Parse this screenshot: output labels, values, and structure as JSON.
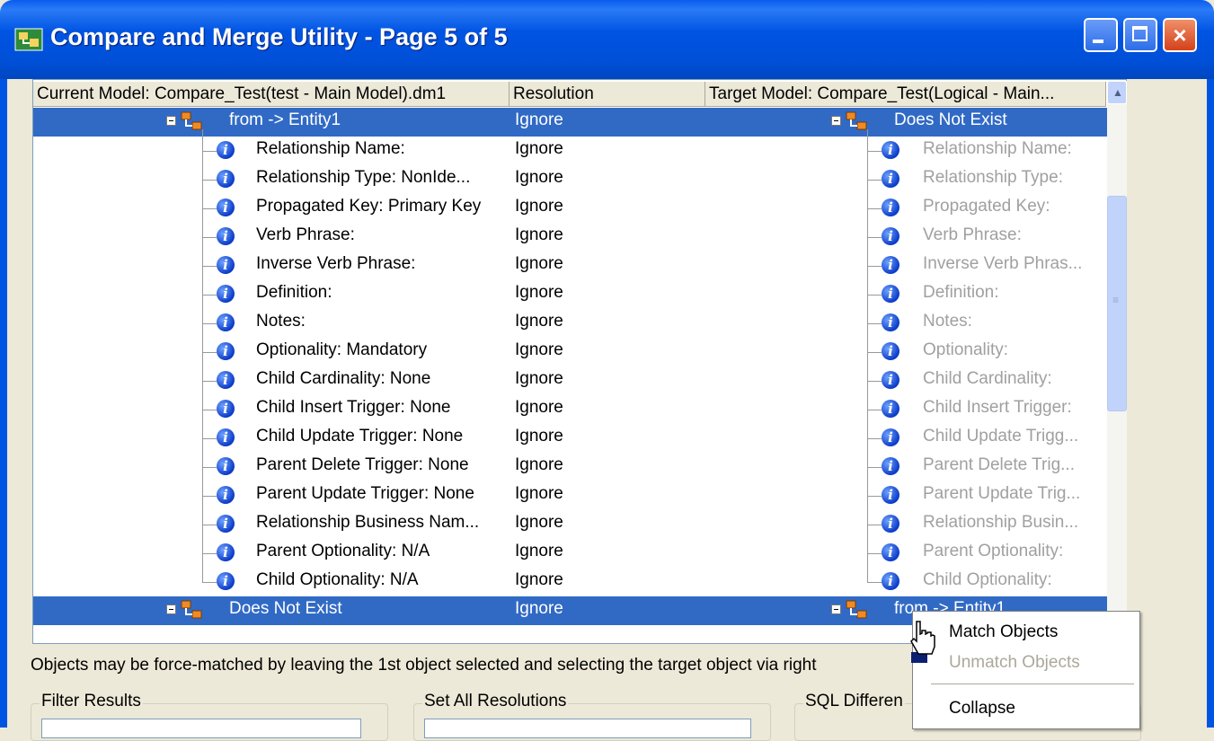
{
  "window": {
    "title": "Compare and Merge Utility  - Page 5 of 5",
    "close_glyph": "×"
  },
  "columns": {
    "current": "Current Model: Compare_Test(test - Main Model).dm1",
    "resolution": "Resolution",
    "target": "Target Model: Compare_Test(Logical - Main..."
  },
  "scroll": {
    "up_glyph": "▲",
    "grip_glyph": "≡"
  },
  "rows": [
    {
      "left": "from -> Entity1",
      "res": "Ignore",
      "right": "Does Not Exist"
    },
    {
      "left": "Relationship Name:",
      "res": "Ignore",
      "right": "Relationship Name:"
    },
    {
      "left": "Relationship Type: NonIde...",
      "res": "Ignore",
      "right": "Relationship Type:"
    },
    {
      "left": "Propagated Key: Primary Key",
      "res": "Ignore",
      "right": "Propagated Key:"
    },
    {
      "left": "Verb Phrase:",
      "res": "Ignore",
      "right": "Verb Phrase:"
    },
    {
      "left": "Inverse Verb Phrase:",
      "res": "Ignore",
      "right": "Inverse Verb Phras..."
    },
    {
      "left": "Definition:",
      "res": "Ignore",
      "right": "Definition:"
    },
    {
      "left": "Notes:",
      "res": "Ignore",
      "right": "Notes:"
    },
    {
      "left": "Optionality: Mandatory",
      "res": "Ignore",
      "right": "Optionality:"
    },
    {
      "left": "Child Cardinality: None",
      "res": "Ignore",
      "right": "Child Cardinality:"
    },
    {
      "left": "Child Insert Trigger: None",
      "res": "Ignore",
      "right": "Child Insert Trigger:"
    },
    {
      "left": "Child Update Trigger: None",
      "res": "Ignore",
      "right": "Child Update Trigg..."
    },
    {
      "left": "Parent Delete Trigger: None",
      "res": "Ignore",
      "right": "Parent Delete Trig..."
    },
    {
      "left": "Parent Update Trigger: None",
      "res": "Ignore",
      "right": "Parent Update Trig..."
    },
    {
      "left": "Relationship Business Nam...",
      "res": "Ignore",
      "right": "Relationship Busin..."
    },
    {
      "left": "Parent Optionality:  N/A",
      "res": "Ignore",
      "right": "Parent Optionality:"
    },
    {
      "left": "Child Optionality:  N/A",
      "res": "Ignore",
      "right": "Child Optionality:"
    },
    {
      "left": "Does Not Exist",
      "res": "Ignore",
      "right": "from -> Entity1"
    }
  ],
  "hint": "Objects may be force-matched by leaving the 1st object selected and selecting the target object via right",
  "groups": {
    "filter": "Filter Results",
    "resolutions": "Set All Resolutions",
    "sql": "SQL Differen"
  },
  "context_menu": {
    "match": "Match Objects",
    "unmatch": "Unmatch Objects",
    "collapse": "Collapse"
  },
  "colors": {
    "selection": "#316ac5",
    "titlebar": "#0054e3",
    "disabled_text": "#a0a0a0",
    "info_icon": "#0b3bc8"
  }
}
